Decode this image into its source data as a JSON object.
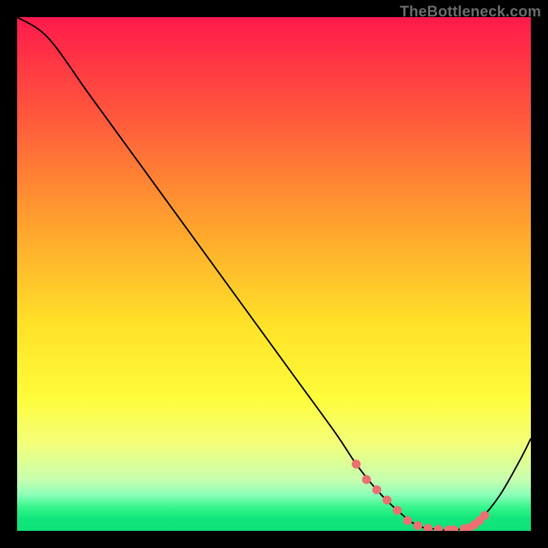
{
  "watermark": "TheBottleneck.com",
  "colors": {
    "marker": "#ec6f72",
    "stroke": "#000000",
    "gradient_stops": [
      {
        "offset": 0.0,
        "color": "#ff1a4b"
      },
      {
        "offset": 0.2,
        "color": "#ff5a3c"
      },
      {
        "offset": 0.4,
        "color": "#ffa12e"
      },
      {
        "offset": 0.6,
        "color": "#ffe228"
      },
      {
        "offset": 0.74,
        "color": "#fffc3a"
      },
      {
        "offset": 0.83,
        "color": "#f3ff7a"
      },
      {
        "offset": 0.9,
        "color": "#c7ffae"
      },
      {
        "offset": 0.93,
        "color": "#8bffb8"
      },
      {
        "offset": 0.955,
        "color": "#34f58a"
      },
      {
        "offset": 0.975,
        "color": "#12e77c"
      },
      {
        "offset": 1.0,
        "color": "#0de178"
      }
    ]
  },
  "chart_data": {
    "type": "line",
    "title": "",
    "xlabel": "",
    "ylabel": "",
    "xlim": [
      0,
      100
    ],
    "ylim": [
      0,
      100
    ],
    "series": [
      {
        "name": "curve",
        "x": [
          0,
          6,
          14,
          22,
          30,
          38,
          46,
          54,
          62,
          66,
          70,
          74,
          78,
          82,
          84,
          88,
          90,
          94,
          98,
          100
        ],
        "y": [
          100,
          96,
          85,
          74,
          63,
          52,
          41,
          30,
          19,
          13,
          8,
          4,
          1,
          0.3,
          0.2,
          0.6,
          2,
          7,
          14,
          18
        ]
      }
    ],
    "markers": {
      "name": "highlight-points",
      "x": [
        66,
        68,
        70,
        72,
        74,
        76,
        78,
        80,
        82,
        84,
        85,
        87,
        88,
        89,
        90,
        91
      ],
      "y": [
        13,
        10,
        8,
        6,
        4,
        2,
        1,
        0.5,
        0.3,
        0.2,
        0.2,
        0.4,
        0.6,
        1.2,
        2,
        3
      ]
    }
  }
}
